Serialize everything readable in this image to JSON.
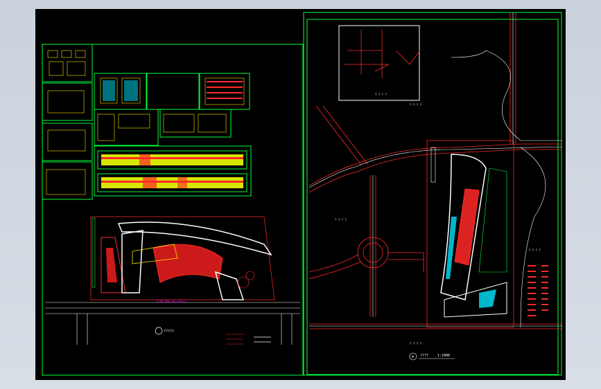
{
  "colors": {
    "background": "#000000",
    "border_green": "#00ff3c",
    "road_red": "#ff2a2a",
    "cyan": "#00e5ff",
    "yellow": "#ffe600",
    "magenta": "#ff00ff",
    "white": "#ffffff"
  },
  "labels": {
    "left_plan_road": "CCAD Bbb Aaa Aaaa",
    "left_plan_title": "?????",
    "site_plan_scale": "1:1000",
    "site_plan_title": "???? ",
    "right_label_1": "? ? ? ?",
    "right_label_2": "? ? ? ?",
    "right_label_3": "? ? ? ?",
    "inset_title": "? ? ? ?",
    "bottom_label": "? ? ? ?",
    "north_label": "A"
  }
}
